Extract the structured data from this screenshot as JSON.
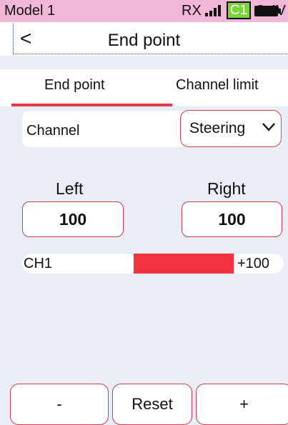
{
  "status": {
    "model": "Model 1",
    "rx_label": "RX",
    "signal_bars": 4,
    "channel_badge": "C1",
    "voltage": "8.4V"
  },
  "header": {
    "back_glyph": "<",
    "title": "End point"
  },
  "tabs": [
    {
      "label": "End point",
      "active": true
    },
    {
      "label": "Channel limit",
      "active": false
    }
  ],
  "channel": {
    "label": "Channel",
    "selected": "Steering"
  },
  "endpoint": {
    "left_label": "Left",
    "left_value": "100",
    "right_label": "Right",
    "right_value": "100"
  },
  "bar": {
    "channel": "CH1",
    "value_label": "+100",
    "value": 100,
    "range": [
      -100,
      100
    ]
  },
  "buttons": {
    "minus": "-",
    "reset": "Reset",
    "plus": "+"
  },
  "colors": {
    "accent": "#e53b46",
    "status_bg": "#f2b6d6",
    "badge_bg": "#7cd33a",
    "bar_fill": "#f0333f",
    "background": "#e9edf5"
  }
}
